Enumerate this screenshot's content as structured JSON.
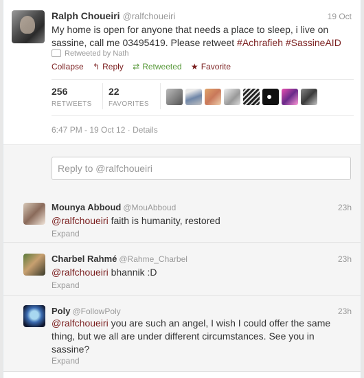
{
  "tweet": {
    "name": "Ralph Choueiri",
    "handle": "@ralfchoueiri",
    "date": "19 Oct",
    "text": "My home is open for anyone that needs a place to sleep, i live on sassine, call me 03495419. Please retweet ",
    "hashtag1": "#Achrafieh",
    "hashtag2": "#SassineAID",
    "retweeted_by": "Retweeted by Nath",
    "actions": {
      "collapse": "Collapse",
      "reply": "Reply",
      "retweeted": "Retweeted",
      "favorite": "Favorite"
    },
    "stats": {
      "retweets_count": "256",
      "retweets_label": "RETWEETS",
      "favorites_count": "22",
      "favorites_label": "FAVORITES"
    },
    "timestamp": "6:47 PM - 19 Oct 12",
    "separator": " · ",
    "details": "Details"
  },
  "reply_input": {
    "placeholder": "Reply to @ralfchoueiri"
  },
  "replies": [
    {
      "name": "Mounya Abboud",
      "handle": "@MouAbboud",
      "time": "23h",
      "mention": "@ralfchoueiri",
      "text": " faith is humanity, restored",
      "expand": "Expand"
    },
    {
      "name": "Charbel Rahmé",
      "handle": "@Rahme_Charbel",
      "time": "23h",
      "mention": "@ralfchoueiri",
      "text": " bhannik :D",
      "expand": "Expand"
    },
    {
      "name": "Poly",
      "handle": "@FollowPoly",
      "time": "23h",
      "mention": "@ralfchoueiri",
      "text": " you are such an angel, I wish I could offer the same thing, but we all are under different circumstances. See you in sassine?",
      "expand": "Expand"
    }
  ],
  "colors": {
    "link": "#7a1e1e",
    "retweet_green": "#5a9a3c",
    "muted": "#999999"
  }
}
